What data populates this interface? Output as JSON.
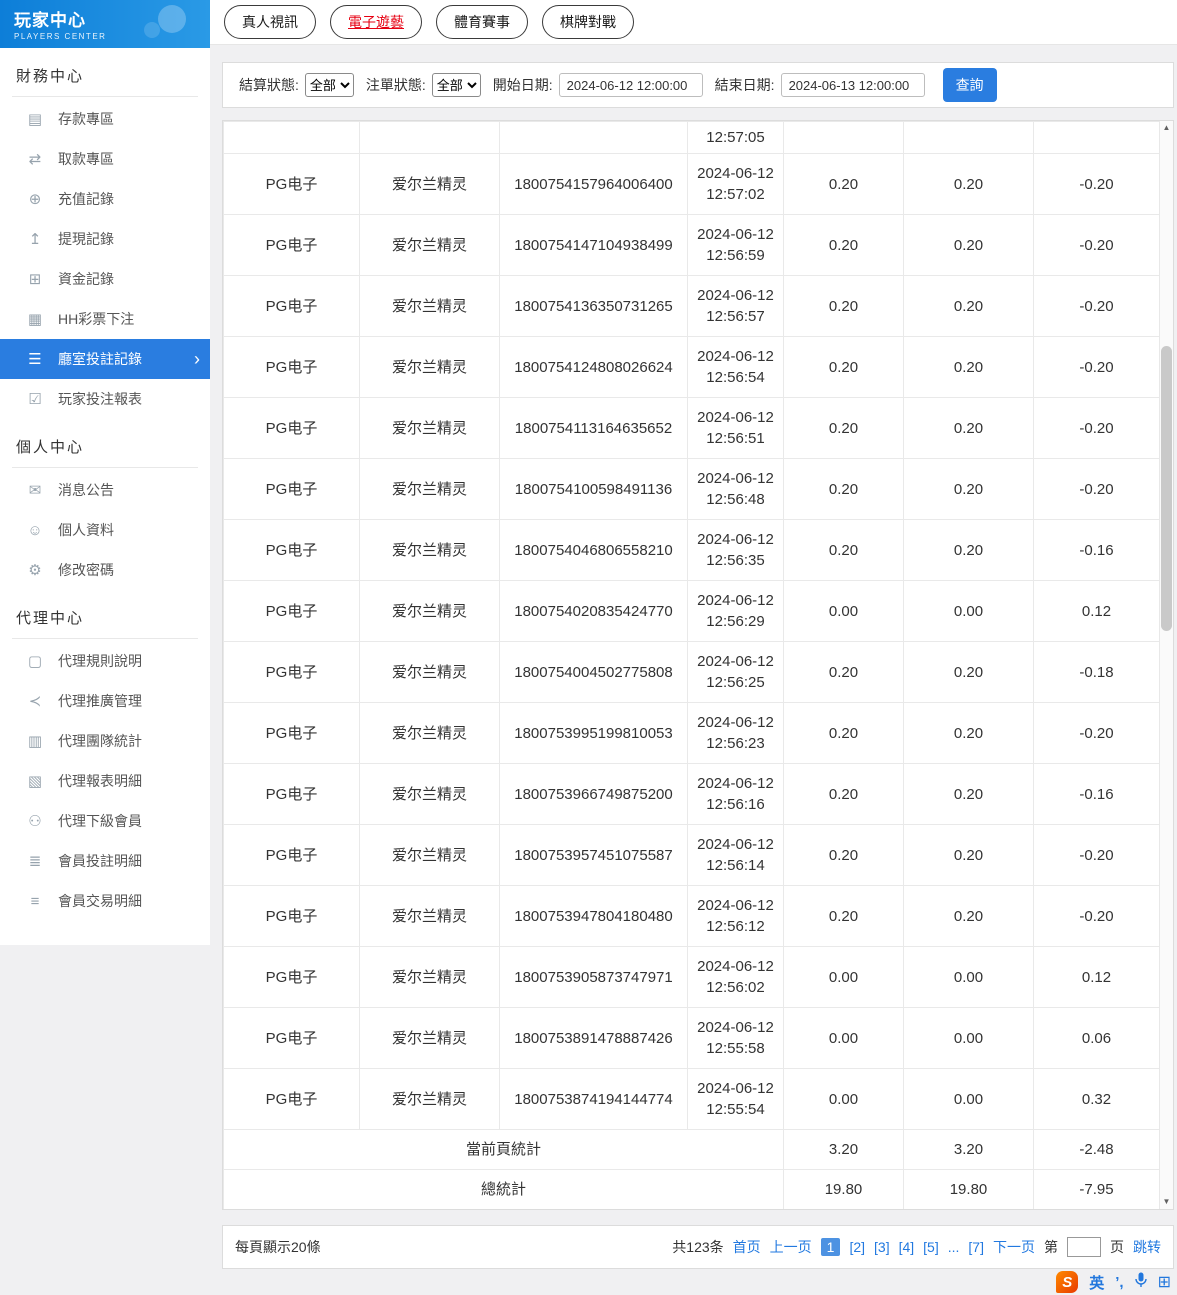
{
  "sidebar": {
    "title": "玩家中心",
    "subtitle": "PLAYERS CENTER",
    "sections": [
      {
        "title": "財務中心",
        "items": [
          {
            "label": "存款專區",
            "icon": "deposit"
          },
          {
            "label": "取款專區",
            "icon": "withdraw"
          },
          {
            "label": "充值記錄",
            "icon": "recharge"
          },
          {
            "label": "提現記錄",
            "icon": "cashout"
          },
          {
            "label": "資金記錄",
            "icon": "funds"
          },
          {
            "label": "HH彩票下注",
            "icon": "lottery"
          },
          {
            "label": "廳室投註記錄",
            "icon": "room-bets",
            "active": true
          },
          {
            "label": "玩家投注報表",
            "icon": "report"
          }
        ]
      },
      {
        "title": "個人中心",
        "items": [
          {
            "label": "消息公告",
            "icon": "announcement"
          },
          {
            "label": "個人資料",
            "icon": "profile"
          },
          {
            "label": "修改密碼",
            "icon": "password-gear"
          }
        ]
      },
      {
        "title": "代理中心",
        "items": [
          {
            "label": "代理規則說明",
            "icon": "rules-doc"
          },
          {
            "label": "代理推廣管理",
            "icon": "share"
          },
          {
            "label": "代理團隊統計",
            "icon": "team-stats"
          },
          {
            "label": "代理報表明細",
            "icon": "report-stats"
          },
          {
            "label": "代理下級會員",
            "icon": "members"
          },
          {
            "label": "會員投註明細",
            "icon": "bet-detail"
          },
          {
            "label": "會員交易明細",
            "icon": "trade-detail"
          }
        ]
      }
    ]
  },
  "tabs": [
    {
      "label": "真人視訊",
      "active": false
    },
    {
      "label": "電子遊藝",
      "active": true
    },
    {
      "label": "體育賽事",
      "active": false
    },
    {
      "label": "棋牌對戰",
      "active": false
    }
  ],
  "filters": {
    "settle_status_label": "結算狀態:",
    "settle_status_value": "全部",
    "order_status_label": "注單狀態:",
    "order_status_value": "全部",
    "start_date_label": "開始日期:",
    "start_date_value": "2024-06-12 12:00:00",
    "end_date_label": "結束日期:",
    "end_date_value": "2024-06-13 12:00:00",
    "search_button": "查詢"
  },
  "table": {
    "partial_row": {
      "time": "12:57:05"
    },
    "rows": [
      {
        "platform": "PG电子",
        "game": "爱尔兰精灵",
        "order_id": "1800754157964006400",
        "date": "2024-06-12",
        "time": "12:57:02",
        "bet": "0.20",
        "valid": "0.20",
        "profit": "-0.20"
      },
      {
        "platform": "PG电子",
        "game": "爱尔兰精灵",
        "order_id": "1800754147104938499",
        "date": "2024-06-12",
        "time": "12:56:59",
        "bet": "0.20",
        "valid": "0.20",
        "profit": "-0.20"
      },
      {
        "platform": "PG电子",
        "game": "爱尔兰精灵",
        "order_id": "1800754136350731265",
        "date": "2024-06-12",
        "time": "12:56:57",
        "bet": "0.20",
        "valid": "0.20",
        "profit": "-0.20"
      },
      {
        "platform": "PG电子",
        "game": "爱尔兰精灵",
        "order_id": "1800754124808026624",
        "date": "2024-06-12",
        "time": "12:56:54",
        "bet": "0.20",
        "valid": "0.20",
        "profit": "-0.20"
      },
      {
        "platform": "PG电子",
        "game": "爱尔兰精灵",
        "order_id": "1800754113164635652",
        "date": "2024-06-12",
        "time": "12:56:51",
        "bet": "0.20",
        "valid": "0.20",
        "profit": "-0.20"
      },
      {
        "platform": "PG电子",
        "game": "爱尔兰精灵",
        "order_id": "1800754100598491136",
        "date": "2024-06-12",
        "time": "12:56:48",
        "bet": "0.20",
        "valid": "0.20",
        "profit": "-0.20"
      },
      {
        "platform": "PG电子",
        "game": "爱尔兰精灵",
        "order_id": "1800754046806558210",
        "date": "2024-06-12",
        "time": "12:56:35",
        "bet": "0.20",
        "valid": "0.20",
        "profit": "-0.16"
      },
      {
        "platform": "PG电子",
        "game": "爱尔兰精灵",
        "order_id": "1800754020835424770",
        "date": "2024-06-12",
        "time": "12:56:29",
        "bet": "0.00",
        "valid": "0.00",
        "profit": "0.12"
      },
      {
        "platform": "PG电子",
        "game": "爱尔兰精灵",
        "order_id": "1800754004502775808",
        "date": "2024-06-12",
        "time": "12:56:25",
        "bet": "0.20",
        "valid": "0.20",
        "profit": "-0.18"
      },
      {
        "platform": "PG电子",
        "game": "爱尔兰精灵",
        "order_id": "1800753995199810053",
        "date": "2024-06-12",
        "time": "12:56:23",
        "bet": "0.20",
        "valid": "0.20",
        "profit": "-0.20"
      },
      {
        "platform": "PG电子",
        "game": "爱尔兰精灵",
        "order_id": "1800753966749875200",
        "date": "2024-06-12",
        "time": "12:56:16",
        "bet": "0.20",
        "valid": "0.20",
        "profit": "-0.16"
      },
      {
        "platform": "PG电子",
        "game": "爱尔兰精灵",
        "order_id": "1800753957451075587",
        "date": "2024-06-12",
        "time": "12:56:14",
        "bet": "0.20",
        "valid": "0.20",
        "profit": "-0.20"
      },
      {
        "platform": "PG电子",
        "game": "爱尔兰精灵",
        "order_id": "1800753947804180480",
        "date": "2024-06-12",
        "time": "12:56:12",
        "bet": "0.20",
        "valid": "0.20",
        "profit": "-0.20"
      },
      {
        "platform": "PG电子",
        "game": "爱尔兰精灵",
        "order_id": "1800753905873747971",
        "date": "2024-06-12",
        "time": "12:56:02",
        "bet": "0.00",
        "valid": "0.00",
        "profit": "0.12"
      },
      {
        "platform": "PG电子",
        "game": "爱尔兰精灵",
        "order_id": "1800753891478887426",
        "date": "2024-06-12",
        "time": "12:55:58",
        "bet": "0.00",
        "valid": "0.00",
        "profit": "0.06"
      },
      {
        "platform": "PG电子",
        "game": "爱尔兰精灵",
        "order_id": "1800753874194144774",
        "date": "2024-06-12",
        "time": "12:55:54",
        "bet": "0.00",
        "valid": "0.00",
        "profit": "0.32"
      }
    ],
    "summary": [
      {
        "label": "當前頁統計",
        "bet": "3.20",
        "valid": "3.20",
        "profit": "-2.48"
      },
      {
        "label": "總統計",
        "bet": "19.80",
        "valid": "19.80",
        "profit": "-7.95"
      }
    ]
  },
  "pagination": {
    "page_size_text": "每頁顯示20條",
    "items": [
      {
        "name": "total-count",
        "label": "共123条",
        "type": "text"
      },
      {
        "name": "first-page-link",
        "label": "首页",
        "type": "link"
      },
      {
        "name": "prev-page-link",
        "label": "上一页",
        "type": "link"
      },
      {
        "name": "page-1",
        "label": "1",
        "type": "current"
      },
      {
        "name": "page-2",
        "label": "[2]",
        "type": "link"
      },
      {
        "name": "page-3",
        "label": "[3]",
        "type": "link"
      },
      {
        "name": "page-4",
        "label": "[4]",
        "type": "link"
      },
      {
        "name": "page-5",
        "label": "[5]",
        "type": "link"
      },
      {
        "name": "page-ellipsis",
        "label": "...",
        "type": "ellipsis"
      },
      {
        "name": "page-7",
        "label": "[7]",
        "type": "link"
      },
      {
        "name": "next-page-link",
        "label": "下一页",
        "type": "link"
      },
      {
        "name": "jump-prefix",
        "label": "第",
        "type": "text"
      },
      {
        "name": "jump-page-input",
        "type": "input"
      },
      {
        "name": "jump-suffix",
        "label": "页",
        "type": "text"
      },
      {
        "name": "jump-button",
        "label": "跳转",
        "type": "link"
      }
    ]
  },
  "ime": {
    "logo": "S",
    "mode": "英",
    "punct": "’,",
    "grid": "⊞"
  }
}
